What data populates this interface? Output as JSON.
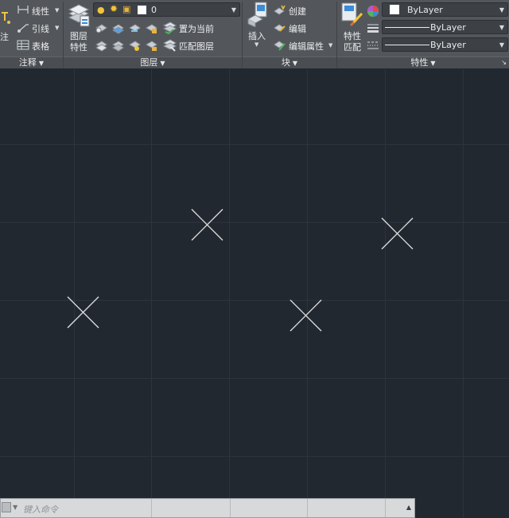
{
  "ribbon": {
    "annotation": {
      "title": "注释",
      "items": [
        {
          "icon": "linear-dimension-icon",
          "label": "线性"
        },
        {
          "icon": "leader-icon",
          "label": "引线"
        },
        {
          "icon": "table-icon",
          "label": "表格"
        }
      ],
      "big_label": "注"
    },
    "layers": {
      "title": "图层",
      "props_label_1": "图层",
      "props_label_2": "特性",
      "current_layer": "0",
      "set_current_label": "置为当前",
      "match_layer_label": "匹配图层"
    },
    "block": {
      "title": "块",
      "insert_label": "插入",
      "create_label": "创建",
      "edit_label": "编辑",
      "edit_attr_label": "编辑属性"
    },
    "properties": {
      "title": "特性",
      "match_label_1": "特性",
      "match_label_2": "匹配",
      "color_value": "ByLayer",
      "linetype_value": "ByLayer",
      "lineweight_value": "ByLayer"
    }
  },
  "command_line": {
    "placeholder": "键入命令"
  },
  "colors": {
    "ribbon_bg": "#53575c",
    "canvas_bg": "#212830",
    "grid": "#2b333d",
    "marker": "#e0e0e0"
  }
}
